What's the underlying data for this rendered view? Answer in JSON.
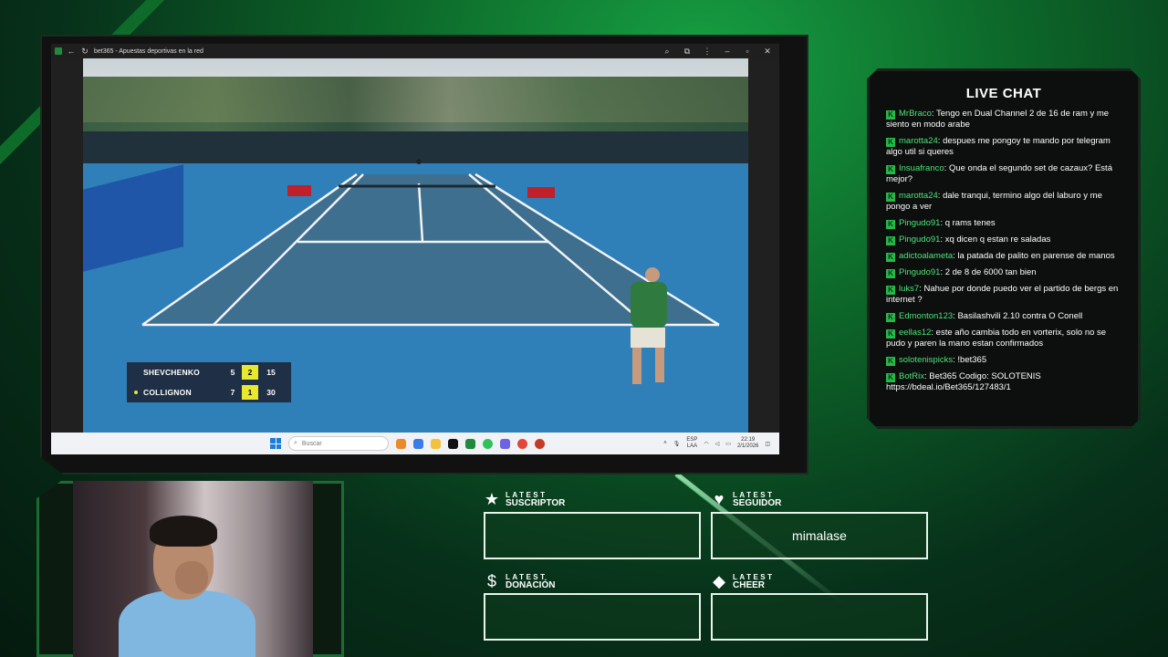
{
  "browser": {
    "title": "bet365 - Apuestas deportivas en la red"
  },
  "scoreboard": {
    "players": [
      {
        "name": "SHEVCHENKO",
        "set1": "5",
        "set2": "2",
        "points": "15",
        "serving": false
      },
      {
        "name": "COLLIGNON",
        "set1": "7",
        "set2": "1",
        "points": "30",
        "serving": true
      }
    ],
    "current_set_color": "#e8e830"
  },
  "taskbar": {
    "search_placeholder": "Buscar",
    "lang_top": "ESP",
    "lang_bottom": "LAA",
    "time": "22:19",
    "date": "2/1/2026"
  },
  "chat": {
    "title": "LIVE CHAT",
    "badge": "K",
    "messages": [
      {
        "user": "MrBraco",
        "text": "Tengo en Dual Channel 2 de 16 de ram y me siento en modo arabe"
      },
      {
        "user": "marotta24",
        "text": "despues me pongoy te mando por telegram algo util si queres"
      },
      {
        "user": "Insuafranco",
        "text": "Que onda el segundo set de cazaux? Está mejor?"
      },
      {
        "user": "marotta24",
        "text": "dale tranqui, termino algo del laburo y me pongo a ver"
      },
      {
        "user": "Pingudo91",
        "text": "q rams tenes"
      },
      {
        "user": "Pingudo91",
        "text": "xq dicen q estan re saladas"
      },
      {
        "user": "adictoalameta",
        "text": "la patada de palito en parense de manos"
      },
      {
        "user": "Pingudo91",
        "text": "2 de 8 de 6000 tan bien"
      },
      {
        "user": "luks7",
        "text": "Nahue por donde puedo ver el partido de bergs en internet ?"
      },
      {
        "user": "Edmonton123",
        "text": "Basilashvili 2.10 contra O Conell"
      },
      {
        "user": "eellas12",
        "text": "este año cambia todo en vorterix, solo no se pudo y paren la mano estan confirmados"
      },
      {
        "user": "solotenispicks",
        "text": "!bet365"
      },
      {
        "user": "BotRix",
        "text": "Bet365 Codigo: SOLOTENIS https://bdeal.io/Bet365/127483/1"
      }
    ]
  },
  "alerts": [
    {
      "id": "suscriptor",
      "small": "LATEST",
      "big": "SUSCRIPTOR",
      "icon": "★",
      "value": ""
    },
    {
      "id": "seguidor",
      "small": "LATEST",
      "big": "SEGUIDOR",
      "icon": "♥",
      "value": "mimalase"
    },
    {
      "id": "donacion",
      "small": "LATEST",
      "big": "DONACIÓN",
      "icon": "$",
      "value": ""
    },
    {
      "id": "cheer",
      "small": "LATEST",
      "big": "CHEER",
      "icon": "◆",
      "value": ""
    }
  ]
}
